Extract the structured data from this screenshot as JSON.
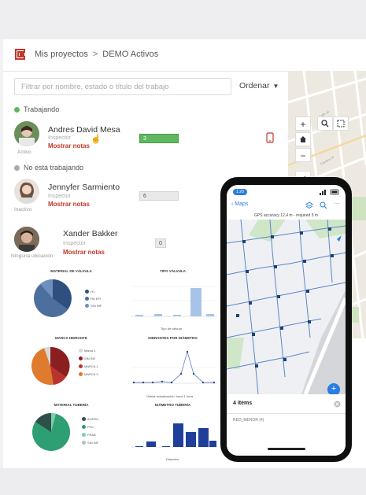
{
  "breadcrumb": {
    "projects": "Mis proyectos",
    "separator": ">",
    "current": "DEMO Activos"
  },
  "search": {
    "placeholder": "Filtrar por nombre, estado o título del trabajo"
  },
  "sort": {
    "label": "Ordenar"
  },
  "sections": {
    "working": "Trabajando",
    "not_working": "No está trabajando"
  },
  "users": [
    {
      "name": "Andres David Mesa",
      "role": "Inspector",
      "notes": "Mostrar notas",
      "status": "Activo",
      "count": "3"
    },
    {
      "name": "Jennyfer Sarmiento",
      "role": "Inspector",
      "notes": "Mostrar notas",
      "status": "Inactivo",
      "count": "6"
    },
    {
      "name": "Xander Bakker",
      "role": "Inspector",
      "notes": "Mostrar notas",
      "status": "Ninguna ubicación",
      "count": "0"
    }
  ],
  "map": {
    "zoom_in": "+",
    "zoom_out": "−",
    "home_icon": "home-icon",
    "search_icon": "search-icon",
    "select_icon": "select-icon",
    "collapse": "<"
  },
  "dashboard": {
    "panels": [
      {
        "title": "MATERIAL DE VÁLVULA",
        "legend": [
          "H.I.",
          "HD EFI",
          "SIN INF"
        ]
      },
      {
        "title": "TIPO VÁLVULA",
        "xlabel": "Tipo de válvula"
      },
      {
        "title": "MARCA HIDRANTE",
        "legend": [
          "Marca 1",
          "SIN INF",
          "MARCA 1",
          "MARCA 2"
        ]
      },
      {
        "title": "HIDRANTES POR DIÁMETRO"
      },
      {
        "title": "MATERIAL TUBERÍA",
        "legend": [
          "ACERO",
          "PVC",
          "PEAD",
          "SIN INF"
        ]
      },
      {
        "title": "DIÁMETRO TUBERÍA",
        "xlabel": "Diámetro"
      }
    ],
    "footer_note": "Última actualización: hace 1 hora"
  },
  "phone": {
    "time": "1:20",
    "back_label": "Maps",
    "gps_text": "GPS accuracy 12,4 m - required 5 m",
    "items_count": "4 items",
    "list_row": "RED_MENOR (4)",
    "fab": "+"
  },
  "colors": {
    "accent": "#c0392b",
    "active_green": "#5fb85f",
    "blue": "#2a7de1",
    "navy": "#1f3f7a"
  }
}
